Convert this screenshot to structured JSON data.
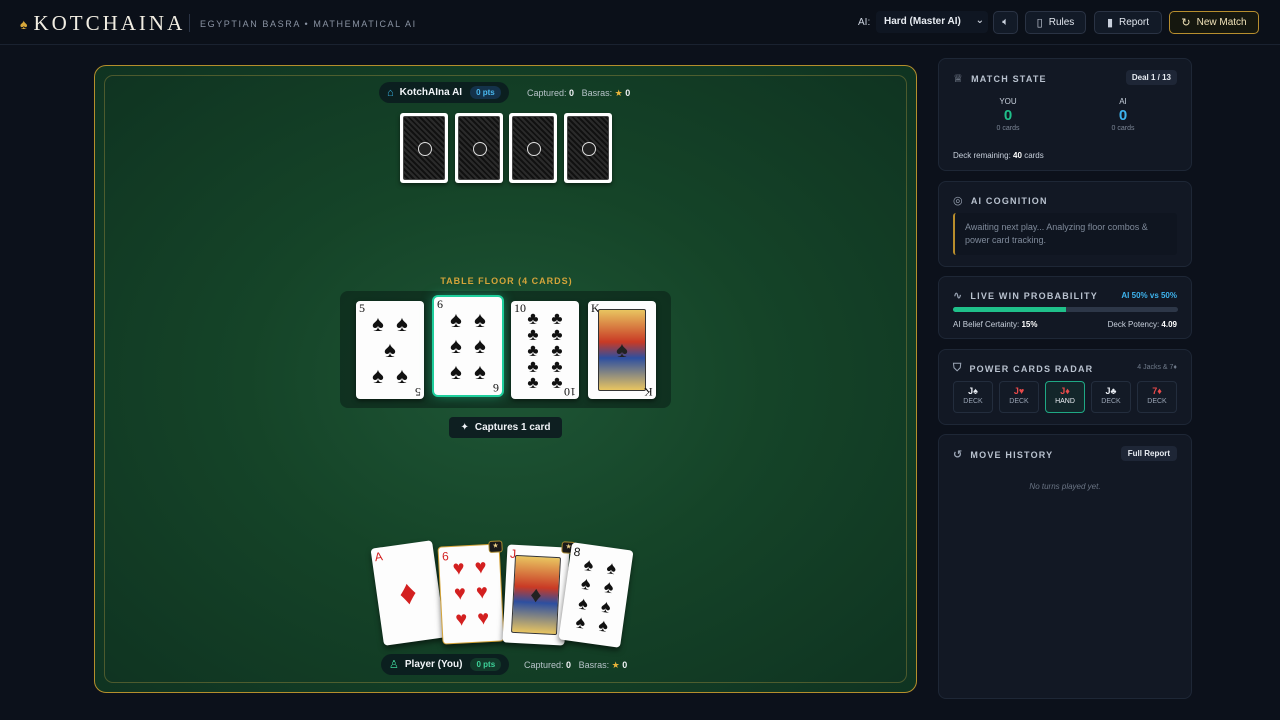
{
  "header": {
    "logo": "KOTCHAINA",
    "subtitle": "EGYPTIAN BASRA • MATHEMATICAL AI",
    "ai_label": "AI:",
    "ai_level": "Hard (Master AI)",
    "rules_label": "Rules",
    "report_label": "Report",
    "new_match_label": "New Match"
  },
  "board": {
    "opponent": {
      "name": "KotchAIna AI",
      "pts": "0 pts",
      "captured_label": "Captured:",
      "captured": "0",
      "basras_label": "Basras:",
      "basras": "0"
    },
    "floor_label": "TABLE FLOOR (4 CARDS)",
    "floor_cards": [
      {
        "rank": "5",
        "suit": "♠",
        "color": "black"
      },
      {
        "rank": "6",
        "suit": "♠",
        "color": "black",
        "highlighted": true
      },
      {
        "rank": "10",
        "suit": "♣",
        "color": "black"
      },
      {
        "rank": "K",
        "suit": "♠",
        "color": "black"
      }
    ],
    "captures_label": "Captures 1 card",
    "hand_cards": [
      {
        "rank": "A",
        "suit": "♦",
        "color": "red"
      },
      {
        "rank": "6",
        "suit": "♥",
        "color": "red"
      },
      {
        "rank": "J",
        "suit": "♦",
        "color": "red"
      },
      {
        "rank": "8",
        "suit": "♠",
        "color": "black"
      }
    ],
    "player": {
      "name": "Player (You)",
      "pts": "0 pts",
      "captured_label": "Captured:",
      "captured": "0",
      "basras_label": "Basras:",
      "basras": "0"
    }
  },
  "match_state": {
    "title": "MATCH STATE",
    "deal": "Deal 1 / 13",
    "you_label": "YOU",
    "you_score": "0",
    "you_cards": "0 cards",
    "ai_label": "AI",
    "ai_score": "0",
    "ai_cards": "0 cards",
    "deck_label": "Deck remaining:",
    "deck_value": "40",
    "deck_unit": "cards"
  },
  "cognition": {
    "title": "AI COGNITION",
    "text": "Awaiting next play... Analyzing floor combos & power card tracking."
  },
  "probability": {
    "title": "LIVE WIN PROBABILITY",
    "summary": "AI 50% vs 50%",
    "fill_fraction": 0.5,
    "certainty_label": "AI Belief Certainty:",
    "certainty_value": "15%",
    "potency_label": "Deck Potency:",
    "potency_value": "4.09"
  },
  "radar": {
    "title": "POWER CARDS RADAR",
    "sub": "4 Jacks & 7♦",
    "chips": [
      {
        "card": "J♠",
        "loc": "DECK",
        "color": "#e8ecf2"
      },
      {
        "card": "J♥",
        "loc": "DECK",
        "color": "#e84a4a"
      },
      {
        "card": "J♦",
        "loc": "HAND",
        "color": "#e84a4a",
        "active": true
      },
      {
        "card": "J♣",
        "loc": "DECK",
        "color": "#e8ecf2"
      },
      {
        "card": "7♦",
        "loc": "DECK",
        "color": "#e84a4a"
      }
    ]
  },
  "history": {
    "title": "MOVE HISTORY",
    "full_report": "Full Report",
    "empty_text": "No turns played yet."
  },
  "colors": {
    "accent": "#d4a43a",
    "board_green": "#154428",
    "ai_blue": "#3eb4ef",
    "player_green": "#1fc08a"
  }
}
